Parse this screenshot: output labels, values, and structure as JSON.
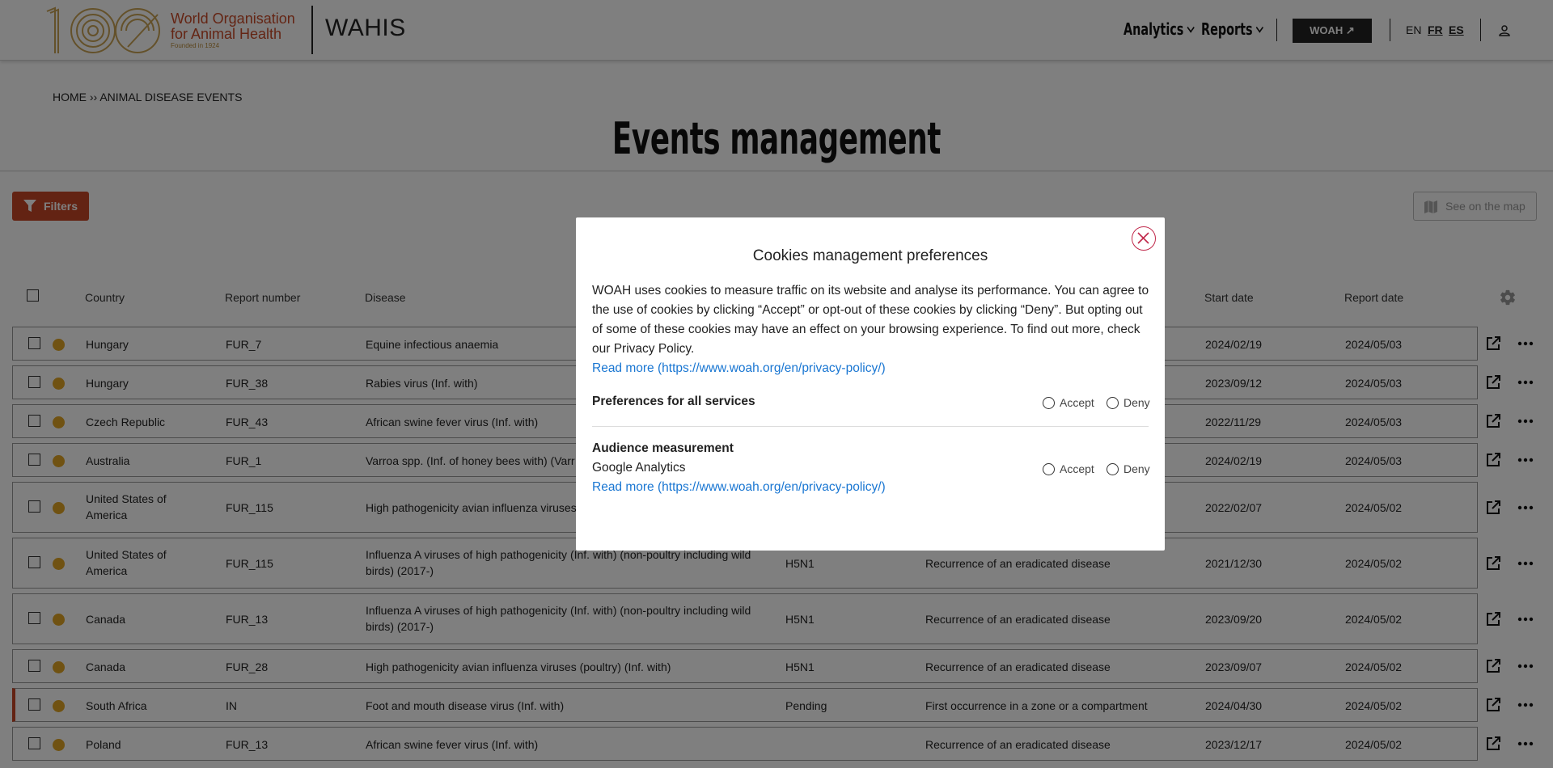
{
  "header": {
    "logo_line1": "World Organisation",
    "logo_line2": "for Animal Health",
    "logo_founded": "Founded in 1924",
    "logo_mark_text": "100",
    "app_name": "WAHIS",
    "nav": {
      "analytics": "Analytics",
      "reports": "Reports"
    },
    "woah_button": "WOAH ↗",
    "languages": [
      "EN",
      "FR",
      "ES"
    ],
    "brand_color": "#c94a28"
  },
  "breadcrumb": "HOME ›› ANIMAL DISEASE EVENTS",
  "page_title": "Events management",
  "toolbar": {
    "filters_label": "Filters",
    "map_label": "See on the map"
  },
  "table": {
    "columns": [
      "Country",
      "Report number",
      "Disease",
      "Start date",
      "Report date"
    ],
    "rows": [
      {
        "country": "Hungary",
        "report_number": "FUR_7",
        "disease": "Equine infectious anaemia",
        "subtype": "",
        "reason": "",
        "start_date": "2024/02/19",
        "report_date": "2024/05/03"
      },
      {
        "country": "Hungary",
        "report_number": "FUR_38",
        "disease": "Rabies virus (Inf. with)",
        "subtype": "",
        "reason": "",
        "start_date": "2023/09/12",
        "report_date": "2024/05/03"
      },
      {
        "country": "Czech Republic",
        "report_number": "FUR_43",
        "disease": "African swine fever virus (Inf. with)",
        "subtype": "",
        "reason": "",
        "start_date": "2022/11/29",
        "report_date": "2024/05/03"
      },
      {
        "country": "Australia",
        "report_number": "FUR_1",
        "disease": "Varroa spp. (Inf. of honey bees with) (Varr",
        "subtype": "",
        "reason": "",
        "start_date": "2024/02/19",
        "report_date": "2024/05/03"
      },
      {
        "country": "United States of America",
        "report_number": "FUR_115",
        "disease": "High pathogenicity avian influenza viruses",
        "subtype": "",
        "reason": "",
        "start_date": "2022/02/07",
        "report_date": "2024/05/02"
      },
      {
        "country": "United States of America",
        "report_number": "FUR_115",
        "disease": "Influenza A viruses of high pathogenicity (Inf. with) (non-poultry including wild birds) (2017-)",
        "subtype": "H5N1",
        "reason": "Recurrence of an eradicated disease",
        "start_date": "2021/12/30",
        "report_date": "2024/05/02"
      },
      {
        "country": "Canada",
        "report_number": "FUR_13",
        "disease": "Influenza A viruses of high pathogenicity (Inf. with) (non-poultry including wild birds) (2017-)",
        "subtype": "H5N1",
        "reason": "Recurrence of an eradicated disease",
        "start_date": "2023/09/20",
        "report_date": "2024/05/02"
      },
      {
        "country": "Canada",
        "report_number": "FUR_28",
        "disease": "High pathogenicity avian influenza viruses (poultry) (Inf. with)",
        "subtype": "H5N1",
        "reason": "Recurrence of an eradicated disease",
        "start_date": "2023/09/07",
        "report_date": "2024/05/02"
      },
      {
        "country": "South Africa",
        "report_number": "IN",
        "disease": "Foot and mouth disease virus (Inf. with)",
        "subtype": "Pending",
        "reason": "First occurrence in a zone or a compartment",
        "start_date": "2024/04/30",
        "report_date": "2024/05/02"
      },
      {
        "country": "Poland",
        "report_number": "FUR_13",
        "disease": "African swine fever virus (Inf. with)",
        "subtype": "",
        "reason": "Recurrence of an eradicated disease",
        "start_date": "2023/12/17",
        "report_date": "2024/05/02"
      }
    ],
    "status_dot_color": "#e0a424"
  },
  "cookie_modal": {
    "title": "Cookies management preferences",
    "body": "WOAH uses cookies to measure traffic on its website and analyse its performance. You can agree to the use of cookies by clicking “Accept” or opt-out of these cookies by clicking “Deny”. But opting out of some of these cookies may have an effect on your browsing experience. To find out more, check our Privacy Policy.",
    "read_more": "Read more (https://www.woah.org/en/privacy-policy/)",
    "all_services_label": "Preferences for all services",
    "accept_label": "Accept",
    "deny_label": "Deny",
    "audience_label": "Audience measurement",
    "audience_service": "Google Analytics",
    "audience_read_more": "Read more (https://www.woah.org/en/privacy-policy/)"
  }
}
